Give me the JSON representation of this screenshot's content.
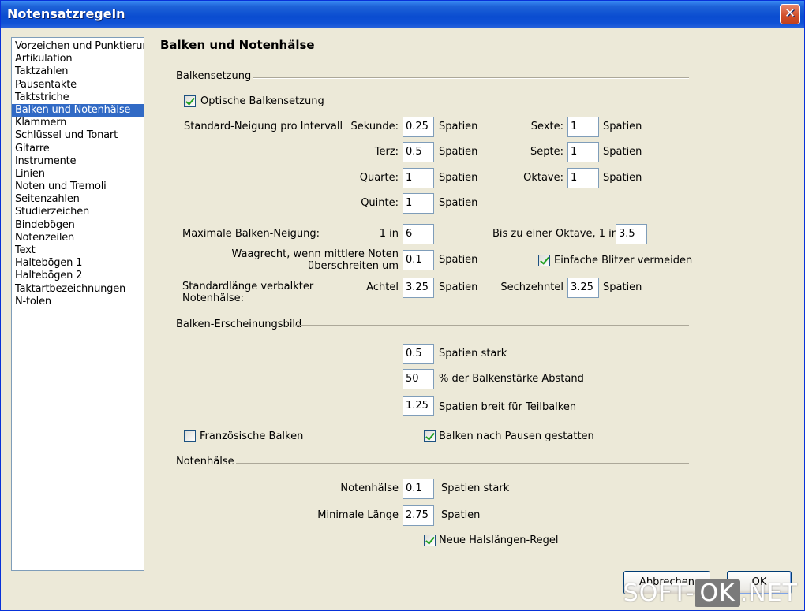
{
  "window": {
    "title": "Notensatzregeln"
  },
  "sidebar": {
    "items": [
      "Vorzeichen und Punktierun",
      "Artikulation",
      "Taktzahlen",
      "Pausentakte",
      "Taktstriche",
      "Balken und Notenhälse",
      "Klammern",
      "Schlüssel und Tonart",
      "Gitarre",
      "Instrumente",
      "Linien",
      "Noten und Tremoli",
      "Seitenzahlen",
      "Studierzeichen",
      "Bindebögen",
      "Notenzeilen",
      "Text",
      "Haltebögen 1",
      "Haltebögen 2",
      "Taktartbezeichnungen",
      "N-tolen"
    ],
    "selected_index": 5
  },
  "page": {
    "heading": "Balken und Notenhälse"
  },
  "balkensetzung": {
    "group_label": "Balkensetzung",
    "optische": {
      "label": "Optische Balkensetzung",
      "checked": true
    },
    "neigung_label": "Standard-Neigung pro Intervall",
    "sekunde": {
      "label": "Sekunde:",
      "value": "0.25",
      "unit": "Spatien"
    },
    "terz": {
      "label": "Terz:",
      "value": "0.5",
      "unit": "Spatien"
    },
    "quarte": {
      "label": "Quarte:",
      "value": "1",
      "unit": "Spatien"
    },
    "quinte": {
      "label": "Quinte:",
      "value": "1",
      "unit": "Spatien"
    },
    "sexte": {
      "label": "Sexte:",
      "value": "1",
      "unit": "Spatien"
    },
    "septe": {
      "label": "Septe:",
      "value": "1",
      "unit": "Spatien"
    },
    "oktave": {
      "label": "Oktave:",
      "value": "1",
      "unit": "Spatien"
    },
    "max_neigung": {
      "label": "Maximale Balken-Neigung:",
      "prefix": "1 in",
      "value": "6"
    },
    "bis_oktave": {
      "label": "Bis zu einer Oktave, 1 in",
      "value": "3.5"
    },
    "waagrecht": {
      "label_line1": "Waagrecht, wenn mittlere Noten",
      "label_line2": "überschreiten um",
      "value": "0.1",
      "unit": "Spatien"
    },
    "blitzer": {
      "label": "Einfache Blitzer vermeiden",
      "checked": true
    },
    "standardlaenge": {
      "label_line1": "Standardlänge verbalkter",
      "label_line2": "Notenhälse:"
    },
    "achtel": {
      "label": "Achtel",
      "value": "3.25",
      "unit": "Spatien"
    },
    "sechzehntel": {
      "label": "Sechzehntel",
      "value": "3.25",
      "unit": "Spatien"
    }
  },
  "erscheinungsbild": {
    "group_label": "Balken-Erscheinungsbild",
    "stark": {
      "value": "0.5",
      "label": "Spatien stark"
    },
    "abstand": {
      "value": "50",
      "label": "% der Balkenstärke Abstand"
    },
    "teilbalken": {
      "value": "1.25",
      "label": "Spatien breit für Teilbalken"
    },
    "franzoesisch": {
      "label": "Französische Balken",
      "checked": false
    },
    "nach_pausen": {
      "label": "Balken nach Pausen gestatten",
      "checked": true
    }
  },
  "notenhaelse": {
    "group_label": "Notenhälse",
    "stark": {
      "label": "Notenhälse",
      "value": "0.1",
      "unit": "Spatien stark"
    },
    "min_laenge": {
      "label": "Minimale Länge",
      "value": "2.75",
      "unit": "Spatien"
    },
    "neue_regel": {
      "label": "Neue Halslängen-Regel",
      "checked": true
    }
  },
  "buttons": {
    "cancel": "Abbrechen",
    "ok": "OK"
  },
  "watermark": {
    "part1": "SOFT-",
    "part2": "OK",
    "part3": ".NET"
  }
}
